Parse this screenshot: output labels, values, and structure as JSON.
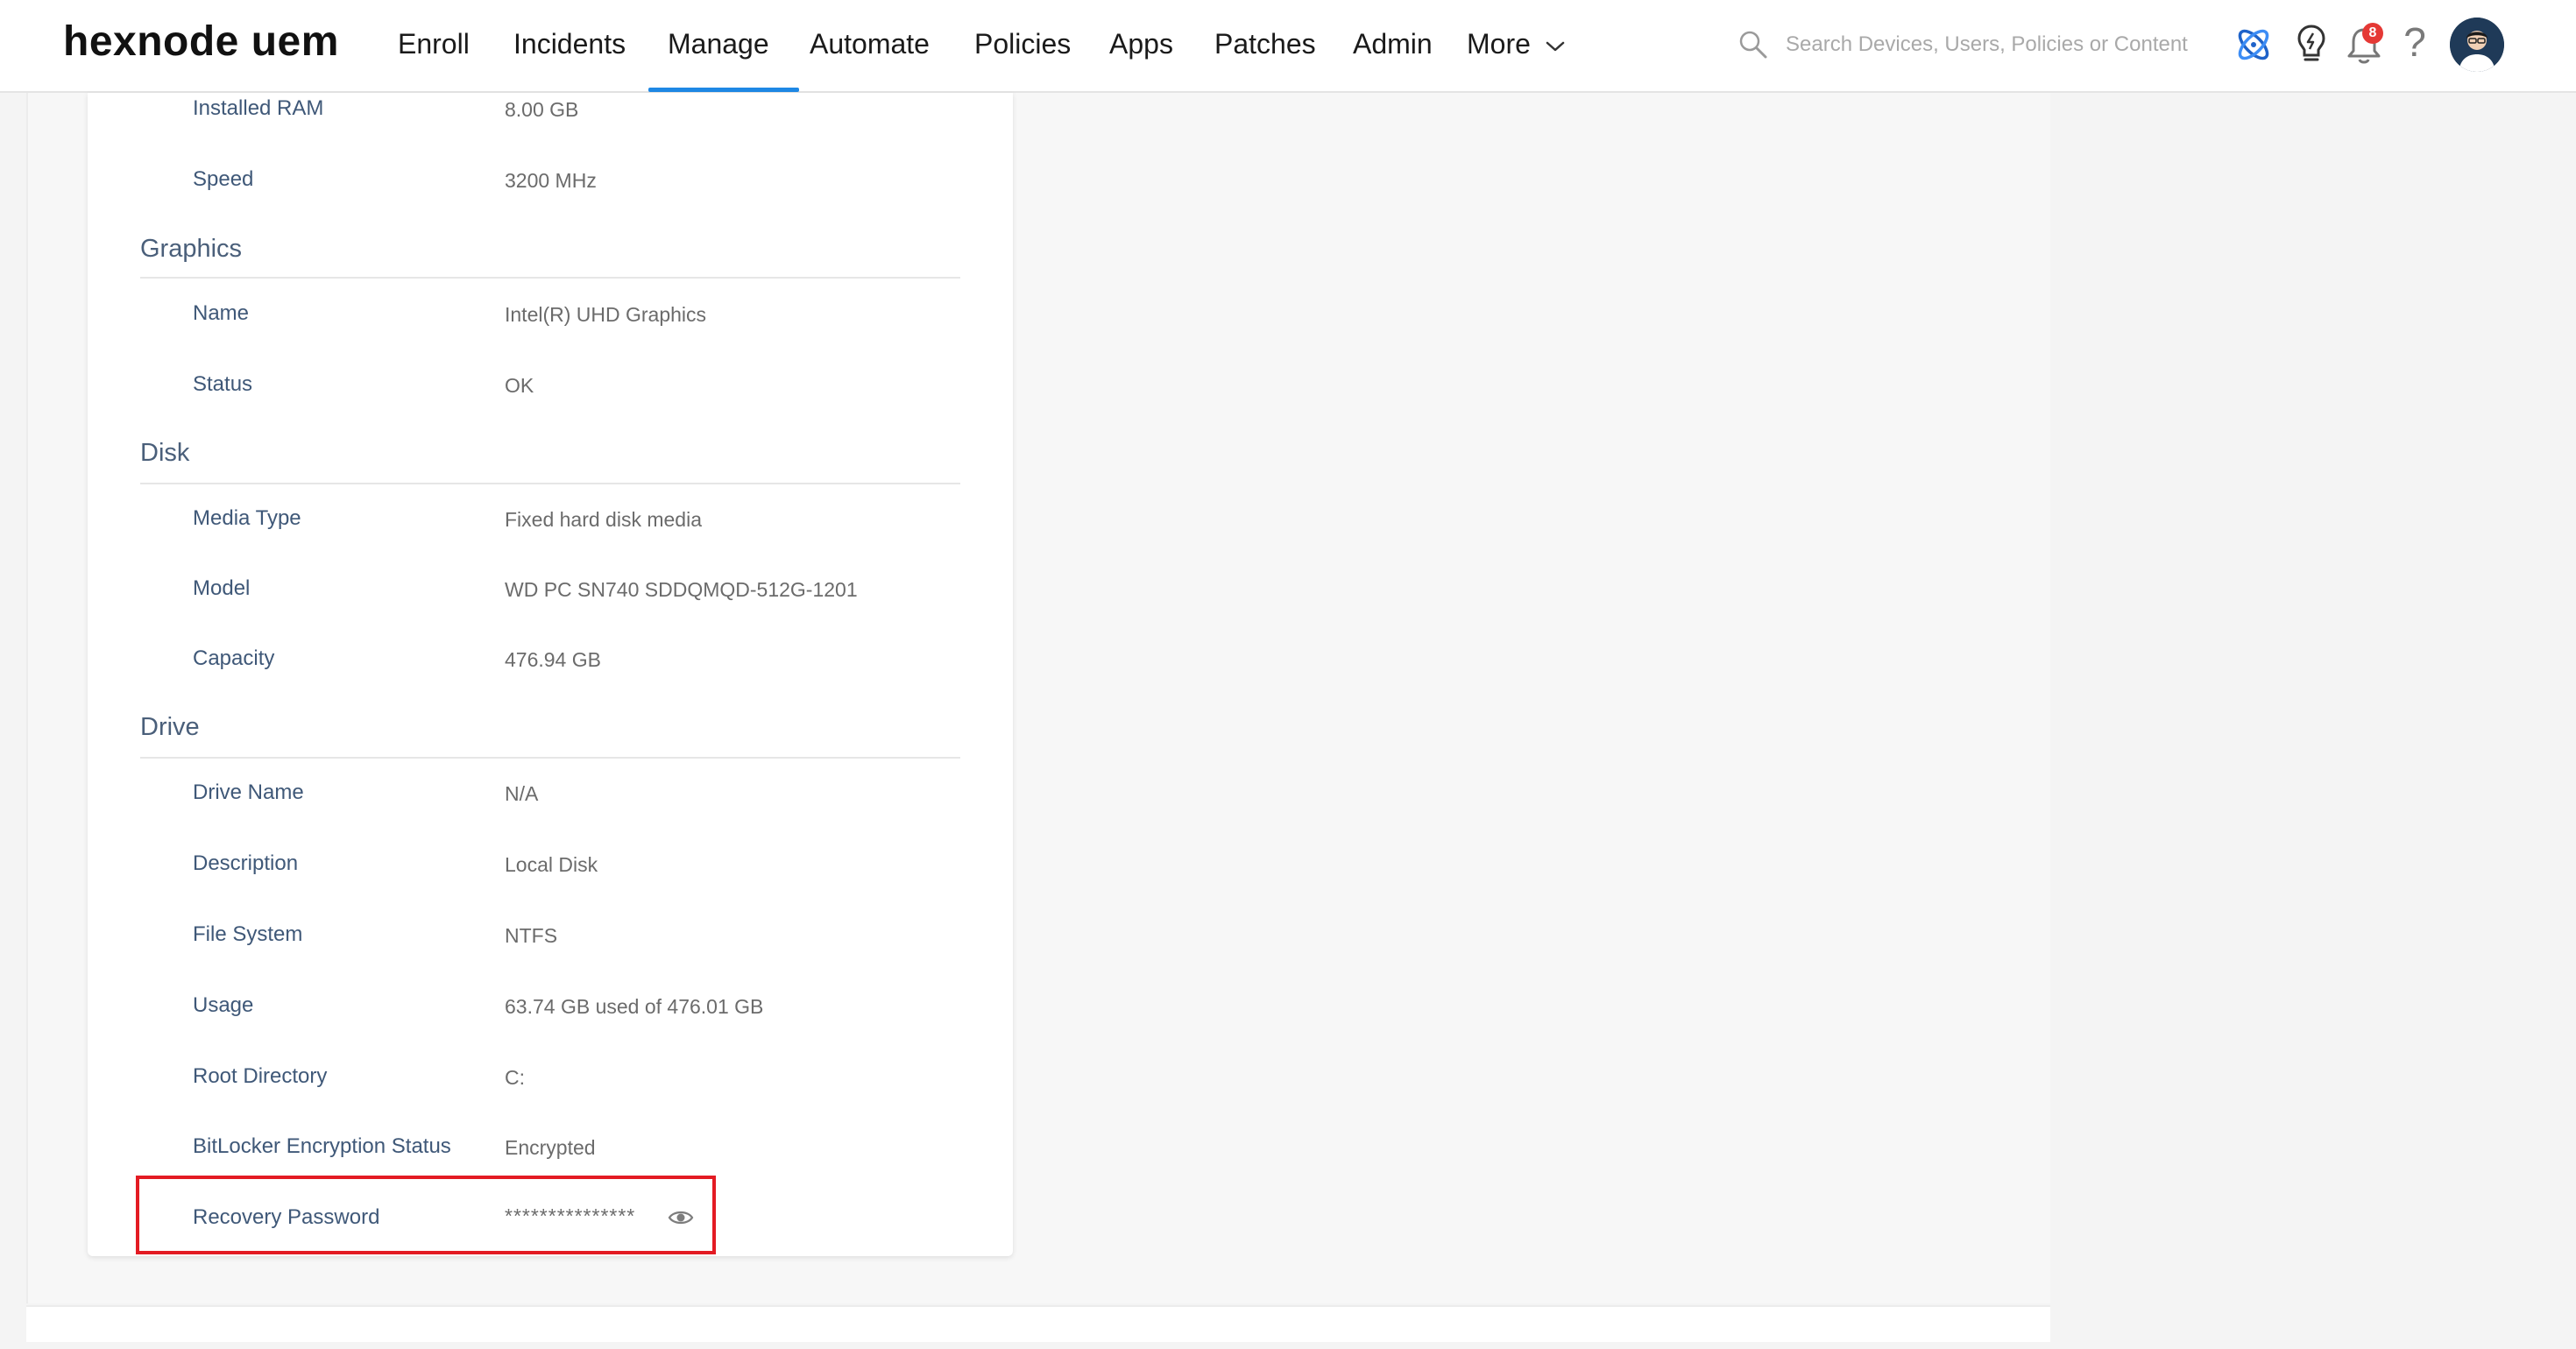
{
  "header": {
    "logo": "hexnode uem",
    "nav": [
      {
        "label": "Enroll"
      },
      {
        "label": "Incidents"
      },
      {
        "label": "Manage",
        "active": true
      },
      {
        "label": "Automate"
      },
      {
        "label": "Policies"
      },
      {
        "label": "Apps"
      },
      {
        "label": "Patches"
      },
      {
        "label": "Admin"
      },
      {
        "label": "More"
      }
    ],
    "search_placeholder": "Search Devices, Users, Policies or Content",
    "notification_count": "8",
    "help_glyph": "?",
    "icons": [
      "atom-icon",
      "bulb-icon",
      "bell-icon",
      "help-icon",
      "avatar"
    ]
  },
  "colors": {
    "accent": "#1e88e5",
    "label": "#3f5878",
    "section": "#4a5f7a",
    "value": "#6b6b6b",
    "highlight": "#e31b23",
    "badge": "#e53935"
  },
  "sections": [
    {
      "title": "",
      "rows": [
        {
          "label": "Installed RAM",
          "value": "8.00 GB"
        },
        {
          "label": "Speed",
          "value": "3200 MHz"
        }
      ]
    },
    {
      "title": "Graphics",
      "rows": [
        {
          "label": "Name",
          "value": "Intel(R) UHD Graphics"
        },
        {
          "label": "Status",
          "value": "OK"
        }
      ]
    },
    {
      "title": "Disk",
      "rows": [
        {
          "label": "Media Type",
          "value": "Fixed hard disk media"
        },
        {
          "label": "Model",
          "value": "WD PC SN740 SDDQMQD-512G-1201"
        },
        {
          "label": "Capacity",
          "value": "476.94 GB"
        }
      ]
    },
    {
      "title": "Drive",
      "rows": [
        {
          "label": "Drive Name",
          "value": "N/A"
        },
        {
          "label": "Description",
          "value": "Local Disk"
        },
        {
          "label": "File System",
          "value": "NTFS"
        },
        {
          "label": "Usage",
          "value": "63.74 GB used of 476.01 GB"
        },
        {
          "label": "Root Directory",
          "value": "C:"
        },
        {
          "label": "BitLocker Encryption Status",
          "value": "Encrypted"
        },
        {
          "label": "Recovery Password",
          "value": "***************",
          "masked": true
        }
      ]
    }
  ]
}
